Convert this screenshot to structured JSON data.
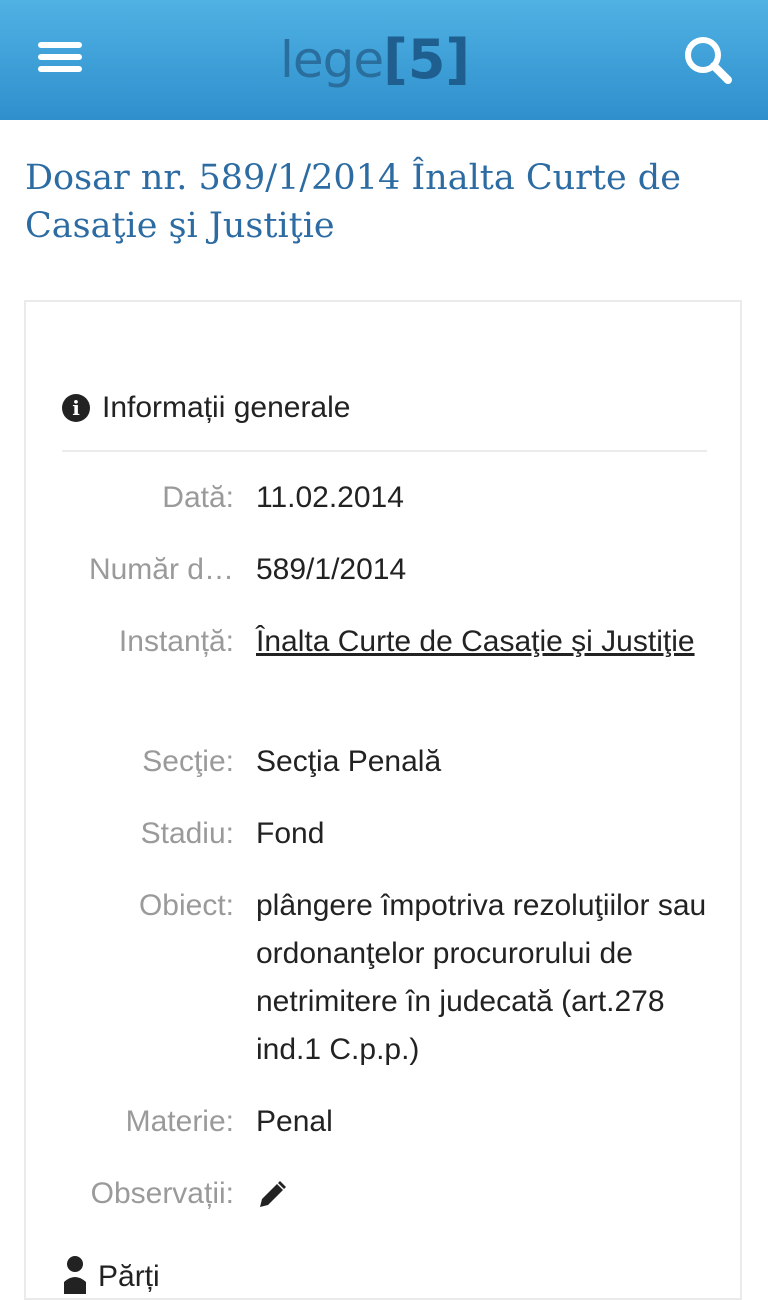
{
  "header": {
    "logo_text": "lege",
    "logo_number": "5",
    "menu_icon": "hamburger-menu-icon",
    "search_icon": "search-icon"
  },
  "page_title": "Dosar nr. 589/1/2014 Înalta Curte de Casaţie şi Justiţie",
  "general_info": {
    "title": "Informații generale",
    "icon": "info-icon",
    "fields": {
      "data": {
        "label": "Dată:",
        "value": "11.02.2014"
      },
      "numar": {
        "label": "Număr d…",
        "value": "589/1/2014"
      },
      "instanta": {
        "label": "Instanță:",
        "value": "Înalta Curte de Casaţie şi Justiţie"
      },
      "sectie": {
        "label": "Secţie:",
        "value": "Secţia Penală"
      },
      "stadiu": {
        "label": "Stadiu:",
        "value": "Fond"
      },
      "obiect": {
        "label": "Obiect:",
        "value": "plângere împotriva rezoluţiilor sau ordonanţelor procurorului de netrimitere în judecată (art.278 ind.1 C.p.p.)"
      },
      "materie": {
        "label": "Materie:",
        "value": "Penal"
      },
      "observatii": {
        "label": "Observații:",
        "icon": "pencil-edit-icon"
      }
    }
  },
  "parties": {
    "title": "Părți",
    "icon": "person-icon"
  },
  "colors": {
    "header_top": "#4fb2e3",
    "header_bottom": "#2f8fcd",
    "title_blue": "#2c6ca3",
    "label_gray": "#9a9a9a"
  }
}
